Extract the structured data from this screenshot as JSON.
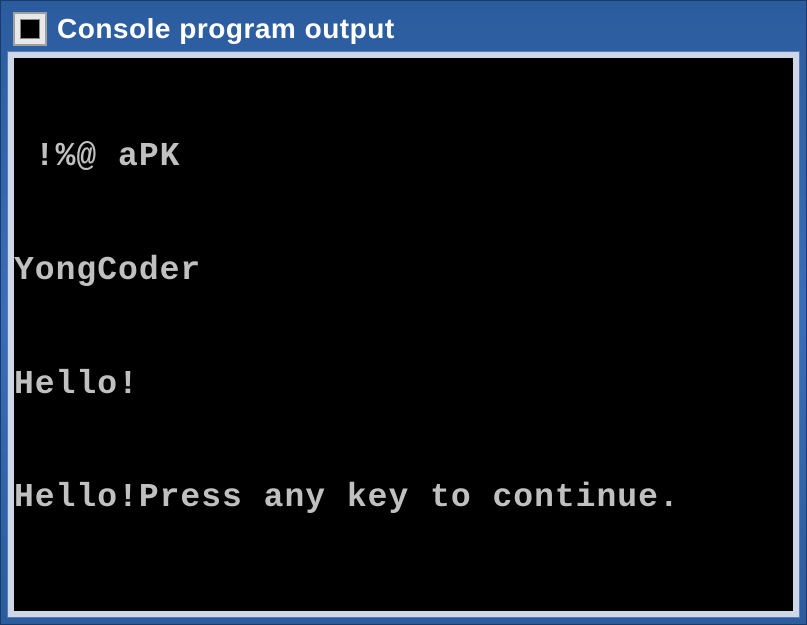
{
  "window": {
    "title": "Console program output"
  },
  "console": {
    "lines": [
      " !%@ aPK",
      "YongCoder",
      "Hello!",
      "Hello!Press any key to continue."
    ]
  }
}
